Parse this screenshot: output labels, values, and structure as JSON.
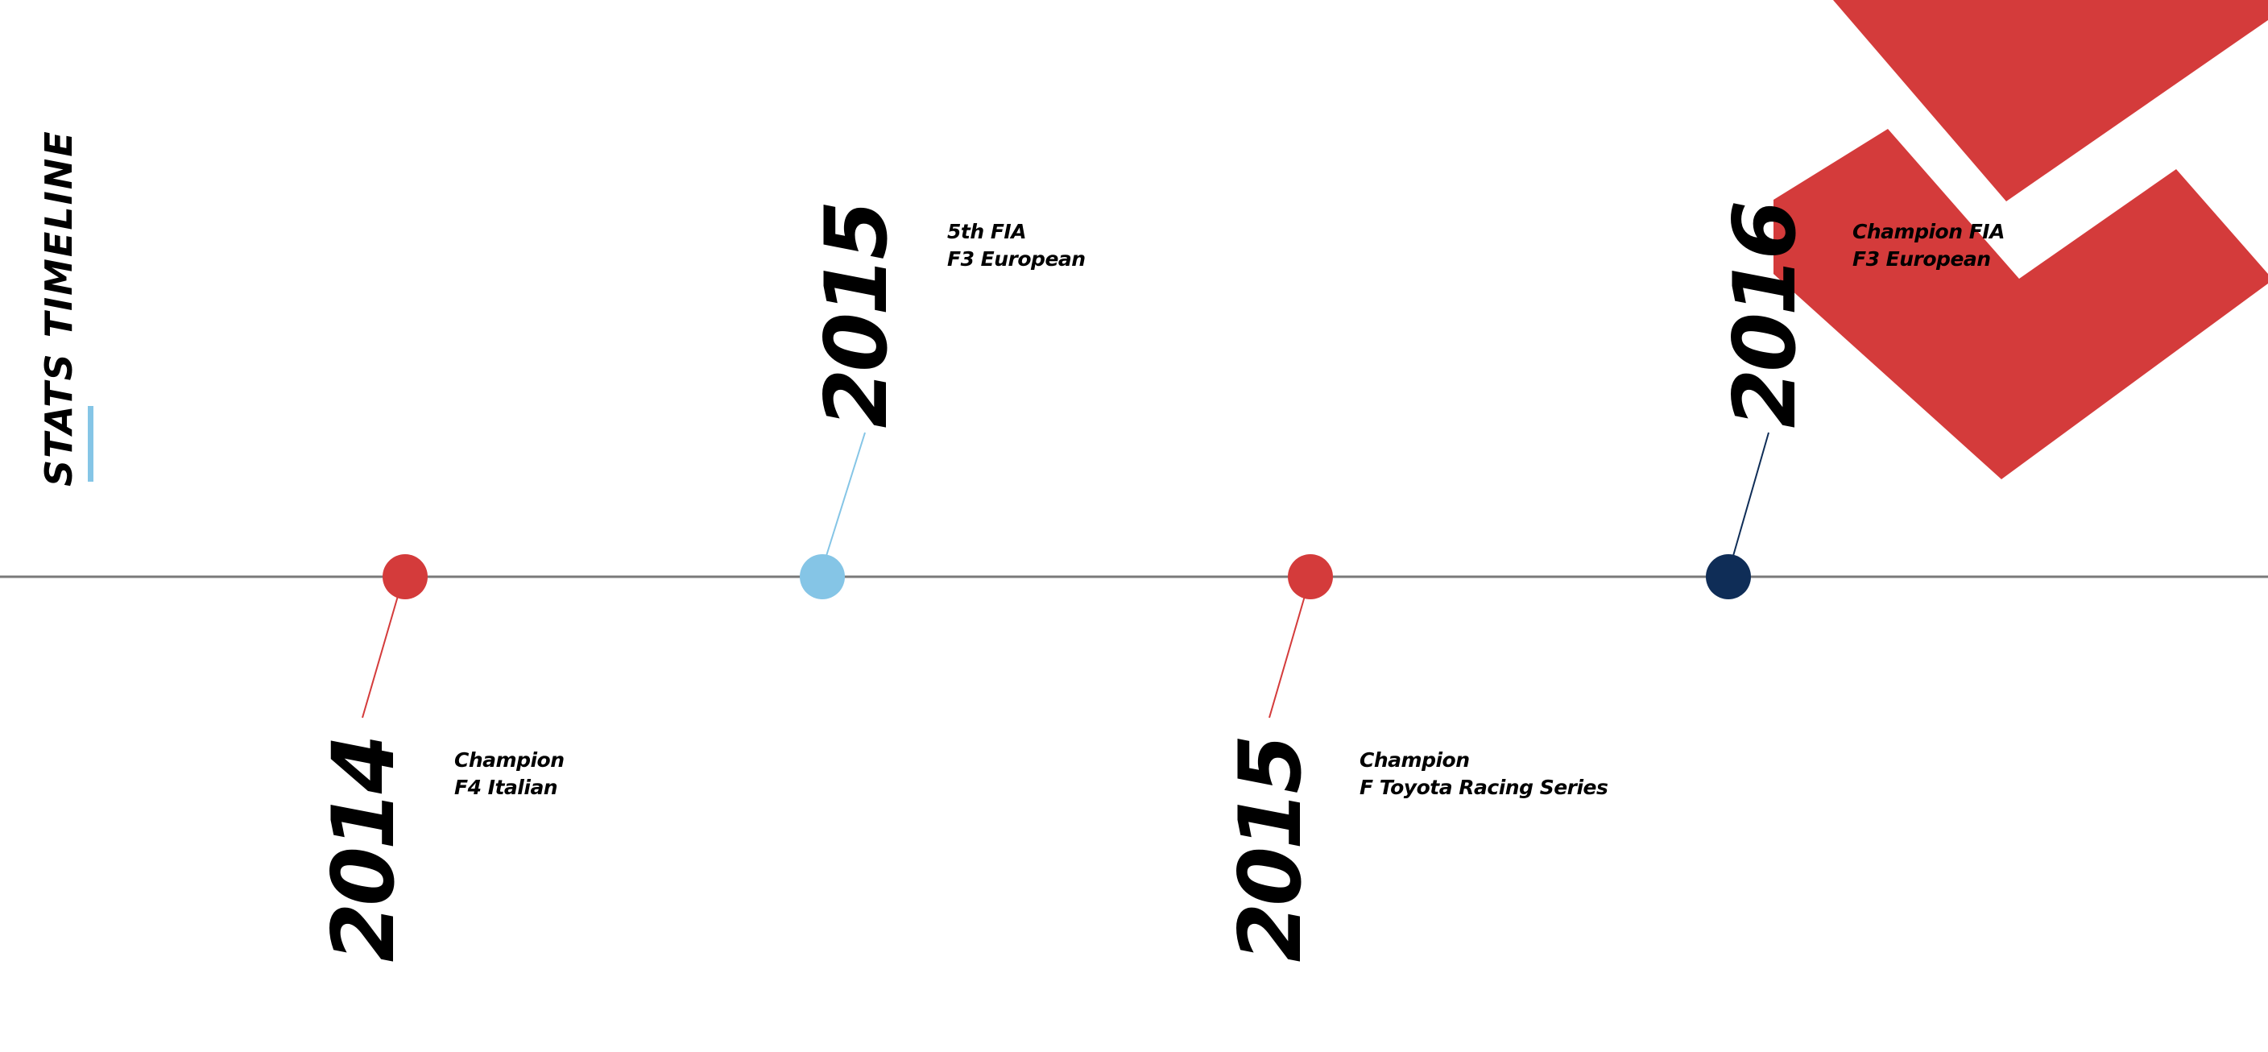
{
  "title": "STATS TIMELINE",
  "colors": {
    "red": "#d43b3b",
    "light_blue": "#85c5e6",
    "navy": "#0f2d57",
    "axis": "#7a7a7a",
    "text": "#000000"
  },
  "milestones": [
    {
      "year": "2014",
      "line1": "Champion",
      "line2": "F4 Italian",
      "color": "red",
      "side": "below"
    },
    {
      "year": "2015",
      "line1": "5th FIA",
      "line2": "F3 European",
      "color": "light_blue",
      "side": "above"
    },
    {
      "year": "2015",
      "line1": "Champion",
      "line2": "F Toyota Racing Series",
      "color": "red",
      "side": "below"
    },
    {
      "year": "2016",
      "line1": "Champion FIA",
      "line2": "F3 European",
      "color": "navy",
      "side": "above"
    }
  ]
}
